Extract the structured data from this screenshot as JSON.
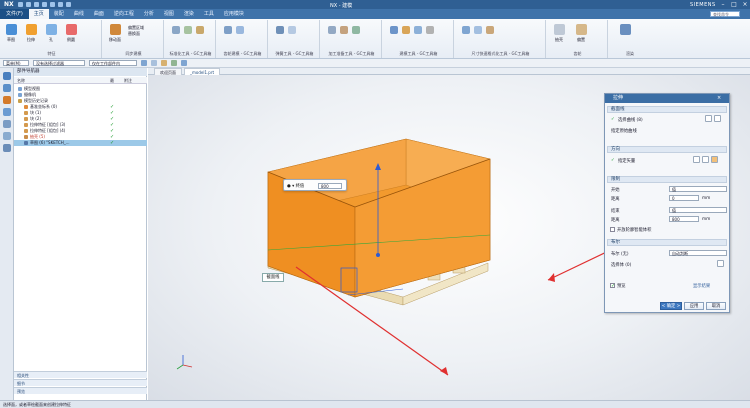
{
  "titlebar": {
    "logo": "NX",
    "window_title": "NX - 建模",
    "brand": "SIEMENS"
  },
  "menubar": {
    "file": "文件(F)",
    "tabs": [
      "主页",
      "装配",
      "曲线",
      "曲面",
      "逆向工程",
      "分析",
      "视图",
      "渲染",
      "工具",
      "应用模块"
    ],
    "active_index": 0,
    "search_placeholder": "查找命令"
  },
  "ribbon": {
    "groups": [
      {
        "label": "特征",
        "items": [
          "草图",
          "拉伸",
          "孔",
          "倒圆"
        ]
      },
      {
        "label": "同步建模",
        "items": [
          "移动面",
          "偏置区域",
          "替换面"
        ]
      },
      {
        "label": "标准化工具 - GC工具箱",
        "items": []
      },
      {
        "label": "齿轮建模 - GC工具箱",
        "items": []
      },
      {
        "label": "弹簧工具 - GC工具箱",
        "items": []
      },
      {
        "label": "加工准备工具 - GC工具箱",
        "items": []
      },
      {
        "label": "建模工具 - GC工具箱",
        "items": []
      },
      {
        "label": "尺寸快速格式化工具 - GC工具箱",
        "items": []
      },
      {
        "label": "齿轮",
        "items": [
          "抽壳",
          "偏置"
        ]
      },
      {
        "label": "渲染",
        "items": [
          "渲染"
        ]
      }
    ]
  },
  "toolbar2": {
    "menu": "菜单(M)",
    "filter": "没有选择过滤器",
    "scope": "仅在工作部件内"
  },
  "nav": {
    "title": "部件导航器",
    "columns": [
      "名称",
      "最",
      "附注"
    ],
    "rows": [
      {
        "label": "模型视图",
        "indent": 1,
        "check": false
      },
      {
        "label": "摄像机",
        "indent": 1,
        "check": false
      },
      {
        "label": "模型历史记录",
        "indent": 1,
        "check": false
      },
      {
        "label": "基准坐标系 (0)",
        "indent": 2,
        "check": true
      },
      {
        "label": "块 (1)",
        "indent": 2,
        "check": true
      },
      {
        "label": "块 (2)",
        "indent": 2,
        "check": true
      },
      {
        "label": "拉伸特征 [组包] (3)",
        "indent": 2,
        "check": true
      },
      {
        "label": "拉伸特征 [组包] (4)",
        "indent": 2,
        "check": true
      },
      {
        "label": "抽壳 (5)",
        "indent": 2,
        "check": true
      },
      {
        "label": "草图 (6) \"SKETCH_...",
        "indent": 2,
        "check": true,
        "selected": true
      }
    ],
    "accordions": [
      "相关性",
      "细节",
      "预览"
    ]
  },
  "tabs": {
    "items": [
      "欢迎页面",
      "_model1.prt"
    ],
    "active_index": 1
  },
  "viewport": {
    "float_value": "800",
    "float_menu": "● ▾ 终值",
    "callout": "截面线"
  },
  "dialog": {
    "title": "拉伸",
    "sections": {
      "section": "截面线",
      "select_curve": "选择曲线 (8)",
      "specify_origin": "指定原始曲线",
      "direction": "方向",
      "specify_vector": "指定矢量",
      "limits": "限制",
      "start_label": "开始",
      "start_value": "值",
      "distance_label": "距离",
      "start_distance": "0",
      "end_label": "结束",
      "end_value": "值",
      "end_distance": "800",
      "unit": "mm",
      "open_profile": "开放轮廓智能体积",
      "boolean": "布尔",
      "boolean_label": "布尔 (无)",
      "boolean_value": "自动判断",
      "select_body": "选择体 (0)",
      "preview": "预览",
      "show_result": "显示结果",
      "ok": "< 确定 >",
      "apply": "应用",
      "cancel": "取消"
    }
  },
  "statusbar": {
    "text": "选择面，或者草绘截面来创建拉伸特征"
  },
  "colors": {
    "accent": "#3b6ea5",
    "box": "#f08c1c",
    "annotation": "#e03030",
    "check": "#1a9a2a"
  }
}
